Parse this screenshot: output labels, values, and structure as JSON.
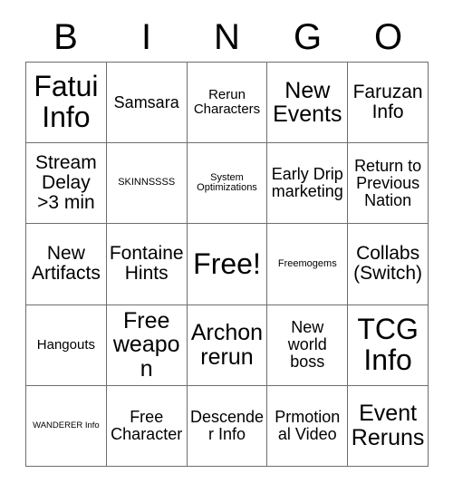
{
  "header": {
    "letters": [
      "B",
      "I",
      "N",
      "G",
      "O"
    ]
  },
  "grid": {
    "rows": 5,
    "columns": 5,
    "cells": [
      {
        "text": "Fatui Info",
        "size": "fs-xxl"
      },
      {
        "text": "Samsara",
        "size": "fs-md"
      },
      {
        "text": "Rerun Characters",
        "size": "fs-sm"
      },
      {
        "text": "New Events",
        "size": "fs-xl"
      },
      {
        "text": "Faruzan Info",
        "size": "fs-lg"
      },
      {
        "text": "Stream Delay >3 min",
        "size": "fs-lg"
      },
      {
        "text": "SKINNSSSS",
        "size": "fs-xs"
      },
      {
        "text": "System Optimizations",
        "size": "fs-xs"
      },
      {
        "text": "Early Drip marketing",
        "size": "fs-md"
      },
      {
        "text": "Return to Previous Nation",
        "size": "fs-md"
      },
      {
        "text": "New Artifacts",
        "size": "fs-lg"
      },
      {
        "text": "Fontaine Hints",
        "size": "fs-lg"
      },
      {
        "text": "Free!",
        "size": "fs-xxl"
      },
      {
        "text": "Freemogems",
        "size": "fs-xs"
      },
      {
        "text": "Collabs (Switch)",
        "size": "fs-lg"
      },
      {
        "text": "Hangouts",
        "size": "fs-sm"
      },
      {
        "text": "Free weapon",
        "size": "fs-xl"
      },
      {
        "text": "Archon rerun",
        "size": "fs-xl"
      },
      {
        "text": "New world boss",
        "size": "fs-md"
      },
      {
        "text": "TCG Info",
        "size": "fs-xxl"
      },
      {
        "text": "WANDERER Info",
        "size": "fs-xxs"
      },
      {
        "text": "Free Character",
        "size": "fs-md"
      },
      {
        "text": "Descender Info",
        "size": "fs-md"
      },
      {
        "text": "Prmotional Video",
        "size": "fs-md"
      },
      {
        "text": "Event Reruns",
        "size": "fs-xl"
      }
    ]
  },
  "colors": {
    "background": "#ffffff",
    "text": "#000000",
    "border": "#6e6e6e"
  }
}
